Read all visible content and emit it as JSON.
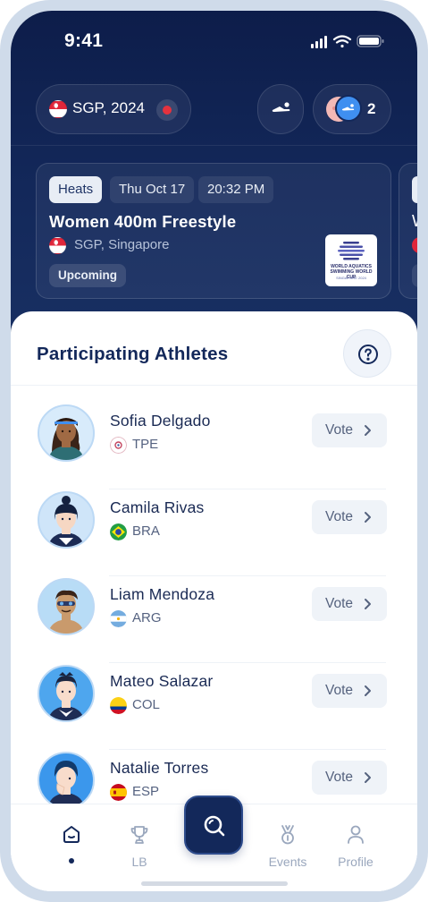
{
  "status_bar": {
    "time": "9:41"
  },
  "header": {
    "location_label": "SGP, 2024",
    "participants_count": "2"
  },
  "event_card": {
    "chips": [
      "Heats",
      "Thu Oct 17",
      "20:32 PM"
    ],
    "title": "Women 400m Freestyle",
    "location": "SGP, Singapore",
    "status": "Upcoming",
    "logo_text": "WORLD AQUATICS SWIMMING WORLD CUP",
    "logo_subtext": "SINGAPORE 2024"
  },
  "next_card": {
    "title_initial": "W"
  },
  "sheet": {
    "title": "Participating Athletes"
  },
  "athletes": [
    {
      "name": "Sofia Delgado",
      "country": "TPE",
      "vote_label": "Vote"
    },
    {
      "name": "Camila Rivas",
      "country": "BRA",
      "vote_label": "Vote"
    },
    {
      "name": "Liam Mendoza",
      "country": "ARG",
      "vote_label": "Vote"
    },
    {
      "name": "Mateo Salazar",
      "country": "COL",
      "vote_label": "Vote"
    },
    {
      "name": "Natalie Torres",
      "country": "ESP",
      "vote_label": "Vote"
    }
  ],
  "tabbar": {
    "home_label": "",
    "lb_label": "LB",
    "events_label": "Events",
    "profile_label": "Profile"
  },
  "colors": {
    "navy": "#13285a",
    "record_red": "#e5323e",
    "accent_blue": "#3f8ff0"
  },
  "icons": {
    "signal": "signal-icon",
    "wifi": "wifi-icon",
    "battery": "battery-icon",
    "swimmer": "swimmer-icon",
    "help": "question-icon",
    "chevron": "chevron-right-icon",
    "home": "home-icon",
    "trophy": "trophy-icon",
    "search": "search-icon",
    "medal": "medal-icon",
    "profile": "user-icon"
  }
}
